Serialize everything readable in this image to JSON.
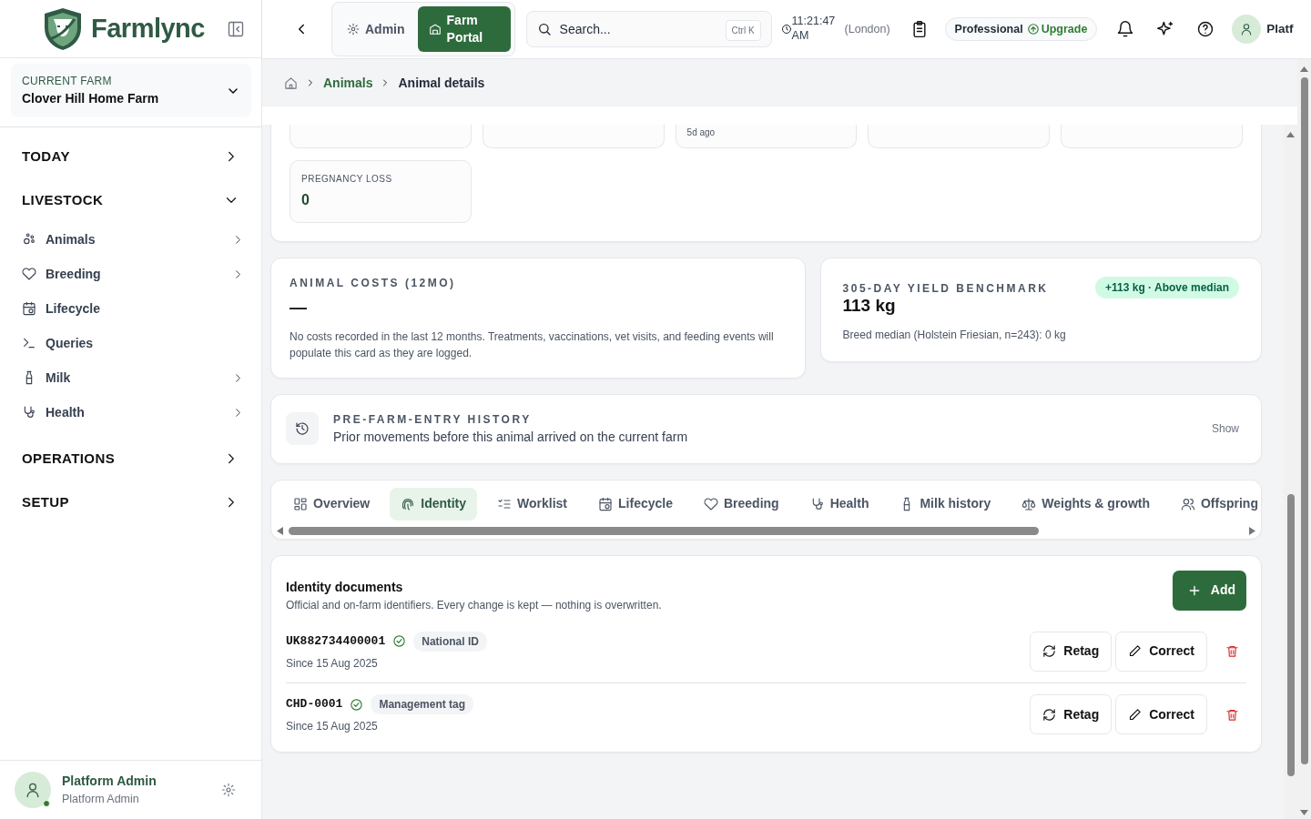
{
  "brand": {
    "name": "Farmlync"
  },
  "farm_switcher": {
    "label": "CURRENT FARM",
    "value": "Clover Hill Home Farm"
  },
  "sidebar": {
    "sections": [
      {
        "label": "TODAY",
        "expanded": false
      },
      {
        "label": "LIVESTOCK",
        "expanded": true,
        "children": [
          {
            "label": "Animals",
            "has_submenu": true
          },
          {
            "label": "Breeding",
            "has_submenu": true
          },
          {
            "label": "Lifecycle",
            "has_submenu": false
          },
          {
            "label": "Queries",
            "has_submenu": false
          },
          {
            "label": "Milk",
            "has_submenu": true
          },
          {
            "label": "Health",
            "has_submenu": true
          }
        ]
      },
      {
        "label": "OPERATIONS",
        "expanded": false
      },
      {
        "label": "SETUP",
        "expanded": false
      }
    ]
  },
  "user": {
    "name": "Platform Admin",
    "role": "Platform Admin",
    "online": true
  },
  "header": {
    "portals": [
      {
        "label": "Admin",
        "selected": false
      },
      {
        "label": "Farm Portal",
        "selected": true
      }
    ],
    "search": {
      "placeholder": "Search...",
      "shortcut": "Ctrl K"
    },
    "time": "11:21:47 AM",
    "timezone": "(London)",
    "plan": "Professional",
    "upgrade": "Upgrade",
    "user_name": "Platf"
  },
  "breadcrumb": [
    {
      "label": "Animals",
      "link": true
    },
    {
      "label": "Animal details",
      "link": false
    }
  ],
  "stat_tiles": [
    {
      "kind": "cut"
    },
    {
      "kind": "cut"
    },
    {
      "kind": "cut",
      "note": "5d ago"
    },
    {
      "kind": "cut"
    },
    {
      "kind": "cut"
    },
    {
      "kind": "full",
      "label": "PREGNANCY LOSS",
      "value": "0"
    }
  ],
  "costs": {
    "title": "ANIMAL COSTS (12MO)",
    "value": "—",
    "note": "No costs recorded in the last 12 months. Treatments, vaccinations, vet visits, and feeding events will populate this card as they are logged."
  },
  "benchmark": {
    "title": "305-DAY YIELD BENCHMARK",
    "value": "113 kg",
    "note": "Breed median (Holstein Friesian, n=243): 0 kg",
    "badge": "+113 kg · Above median"
  },
  "history": {
    "title": "PRE-FARM-ENTRY HISTORY",
    "subtitle": "Prior movements before this animal arrived on the current farm",
    "action": "Show"
  },
  "tabs": [
    {
      "label": "Overview",
      "selected": false
    },
    {
      "label": "Identity",
      "selected": true
    },
    {
      "label": "Worklist",
      "selected": false
    },
    {
      "label": "Lifecycle",
      "selected": false
    },
    {
      "label": "Breeding",
      "selected": false
    },
    {
      "label": "Health",
      "selected": false
    },
    {
      "label": "Milk history",
      "selected": false
    },
    {
      "label": "Weights & growth",
      "selected": false
    },
    {
      "label": "Offspring",
      "selected": false
    }
  ],
  "identity": {
    "title": "Identity documents",
    "subtitle": "Official and on-farm identifiers. Every change is kept — nothing is overwritten.",
    "add": "Add",
    "documents": [
      {
        "id": "UK882734400001",
        "verified": true,
        "type": "National ID",
        "since": "Since 15 Aug 2025",
        "actions": [
          "Retag",
          "Correct"
        ]
      },
      {
        "id": "CHD-0001",
        "verified": true,
        "type": "Management tag",
        "since": "Since 15 Aug 2025",
        "actions": [
          "Retag",
          "Correct"
        ]
      }
    ]
  }
}
